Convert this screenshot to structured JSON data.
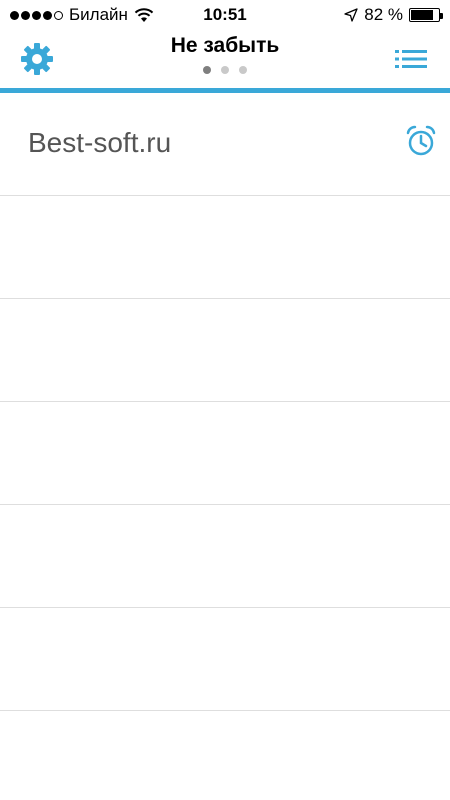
{
  "status": {
    "carrier": "Билайн",
    "time": "10:51",
    "battery": "82 %",
    "battery_level": 0.82,
    "signal_bars": 4,
    "signal_total": 5
  },
  "nav": {
    "title": "Не забыть",
    "pages": 3,
    "active_page": 0
  },
  "colors": {
    "accent": "#3aa8d8"
  },
  "icons": {
    "settings": "gear-icon",
    "list": "list-icon",
    "alarm": "alarm-clock-icon"
  },
  "items": [
    {
      "text": "Best-soft.ru",
      "has_alarm": true
    },
    {
      "text": ""
    },
    {
      "text": ""
    },
    {
      "text": ""
    },
    {
      "text": ""
    },
    {
      "text": ""
    }
  ]
}
